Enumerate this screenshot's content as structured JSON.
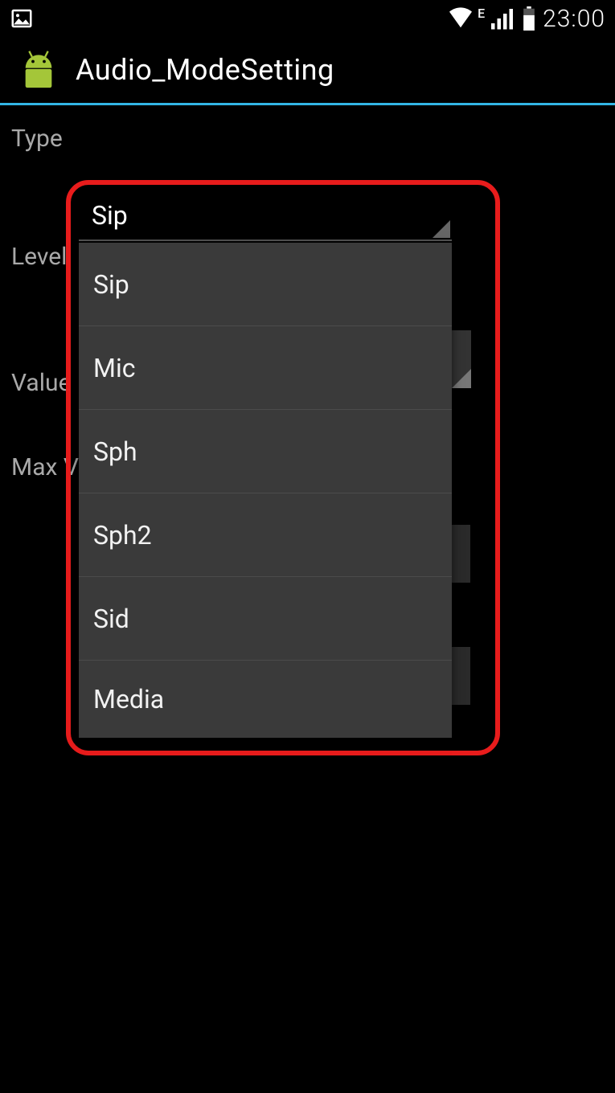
{
  "status_bar": {
    "network_indicator": "E",
    "clock": "23:00"
  },
  "app": {
    "title": "Audio_ModeSetting"
  },
  "labels": {
    "type": "Type",
    "level": "Level",
    "value": "Value",
    "max": "Max V"
  },
  "type_spinner": {
    "selected": "Sip",
    "options": [
      "Sip",
      "Mic",
      "Sph",
      "Sph2",
      "Sid",
      "Media"
    ]
  }
}
